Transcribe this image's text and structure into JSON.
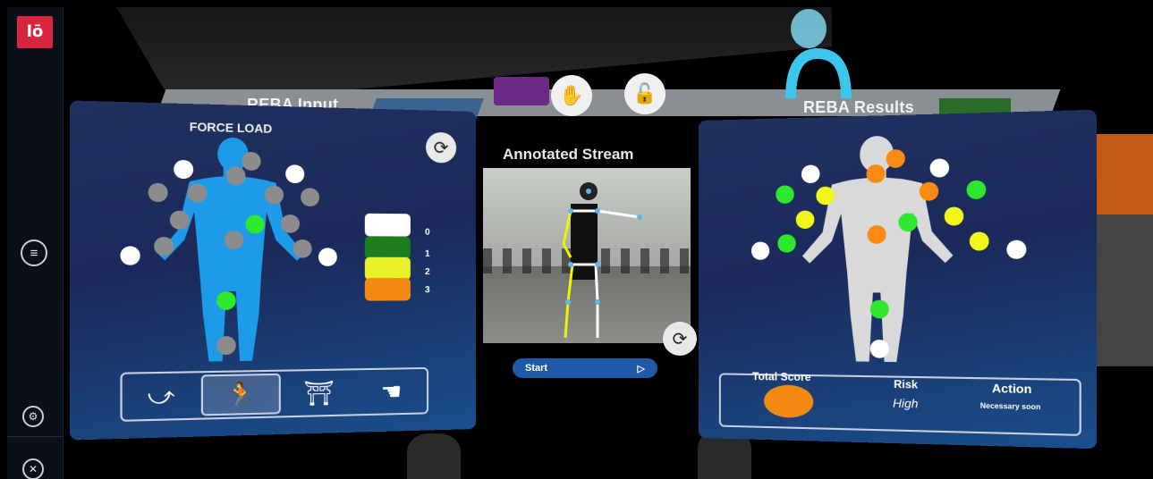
{
  "app": {
    "logo_text": "lō"
  },
  "sidebar": {
    "menu_icon": "menu-icon",
    "settings_icon": "gear-icon",
    "close_icon": "close-icon"
  },
  "toolbar": {
    "hand_icon": "hand-icon",
    "lock_icon": "unlock-icon"
  },
  "left_panel": {
    "title": "REBA Input",
    "subtitle": "FORCE LOAD",
    "legend": [
      {
        "label": "0",
        "color": "#ffffff"
      },
      {
        "label": "1",
        "color": "#1e7d1e"
      },
      {
        "label": "2",
        "color": "#e9f229"
      },
      {
        "label": "3",
        "color": "#f28a12"
      }
    ],
    "tools": [
      "rotate-body-icon",
      "push-load-icon",
      "desk-worker-icon",
      "hand-grip-icon"
    ]
  },
  "stream": {
    "title": "Annotated Stream",
    "start_label": "Start",
    "play_icon": "▷"
  },
  "right_panel": {
    "title": "REBA Results",
    "total_score_label": "Total Score",
    "risk_label": "Risk",
    "risk_value": "High",
    "action_label": "Action",
    "action_value": "Necessary soon",
    "score_color": "#f28a12"
  }
}
